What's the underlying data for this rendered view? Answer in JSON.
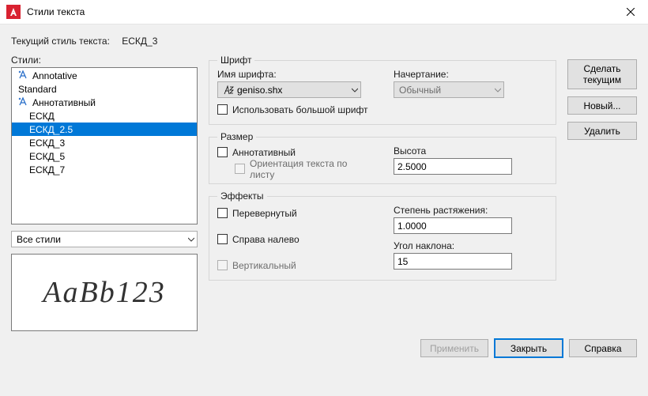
{
  "window": {
    "title": "Стили текста"
  },
  "current_style": {
    "label": "Текущий стиль текста:",
    "value": "ЕСКД_3"
  },
  "styles": {
    "label": "Стили:",
    "items": [
      {
        "label": "Annotative",
        "annot": true,
        "indent": 0,
        "sel": false
      },
      {
        "label": "Standard",
        "annot": false,
        "indent": 0,
        "sel": false
      },
      {
        "label": "Аннотативный",
        "annot": true,
        "indent": 0,
        "sel": false
      },
      {
        "label": "ЕСКД",
        "annot": false,
        "indent": 1,
        "sel": false
      },
      {
        "label": "ЕСКД_2.5",
        "annot": false,
        "indent": 1,
        "sel": true
      },
      {
        "label": "ЕСКД_3",
        "annot": false,
        "indent": 1,
        "sel": false
      },
      {
        "label": "ЕСКД_5",
        "annot": false,
        "indent": 1,
        "sel": false
      },
      {
        "label": "ЕСКД_7",
        "annot": false,
        "indent": 1,
        "sel": false
      }
    ],
    "filter": "Все стили"
  },
  "preview_text": "AaBb123",
  "font": {
    "group": "Шрифт",
    "name_label": "Имя шрифта:",
    "name_value": "geniso.shx",
    "style_label": "Начертание:",
    "style_value": "Обычный",
    "bigfont_label": "Использовать большой шрифт"
  },
  "size": {
    "group": "Размер",
    "annot_label": "Аннотативный",
    "orient_label": "Ориентация текста по листу",
    "height_label": "Высота",
    "height_value": "2.5000"
  },
  "effects": {
    "group": "Эффекты",
    "upside_label": "Перевернутый",
    "backwards_label": "Справа налево",
    "vertical_label": "Вертикальный",
    "width_label": "Степень растяжения:",
    "width_value": "1.0000",
    "oblique_label": "Угол наклона:",
    "oblique_value": "15"
  },
  "buttons": {
    "set_current": "Сделать текущим",
    "new": "Новый...",
    "delete": "Удалить",
    "apply": "Применить",
    "close": "Закрыть",
    "help": "Справка"
  }
}
